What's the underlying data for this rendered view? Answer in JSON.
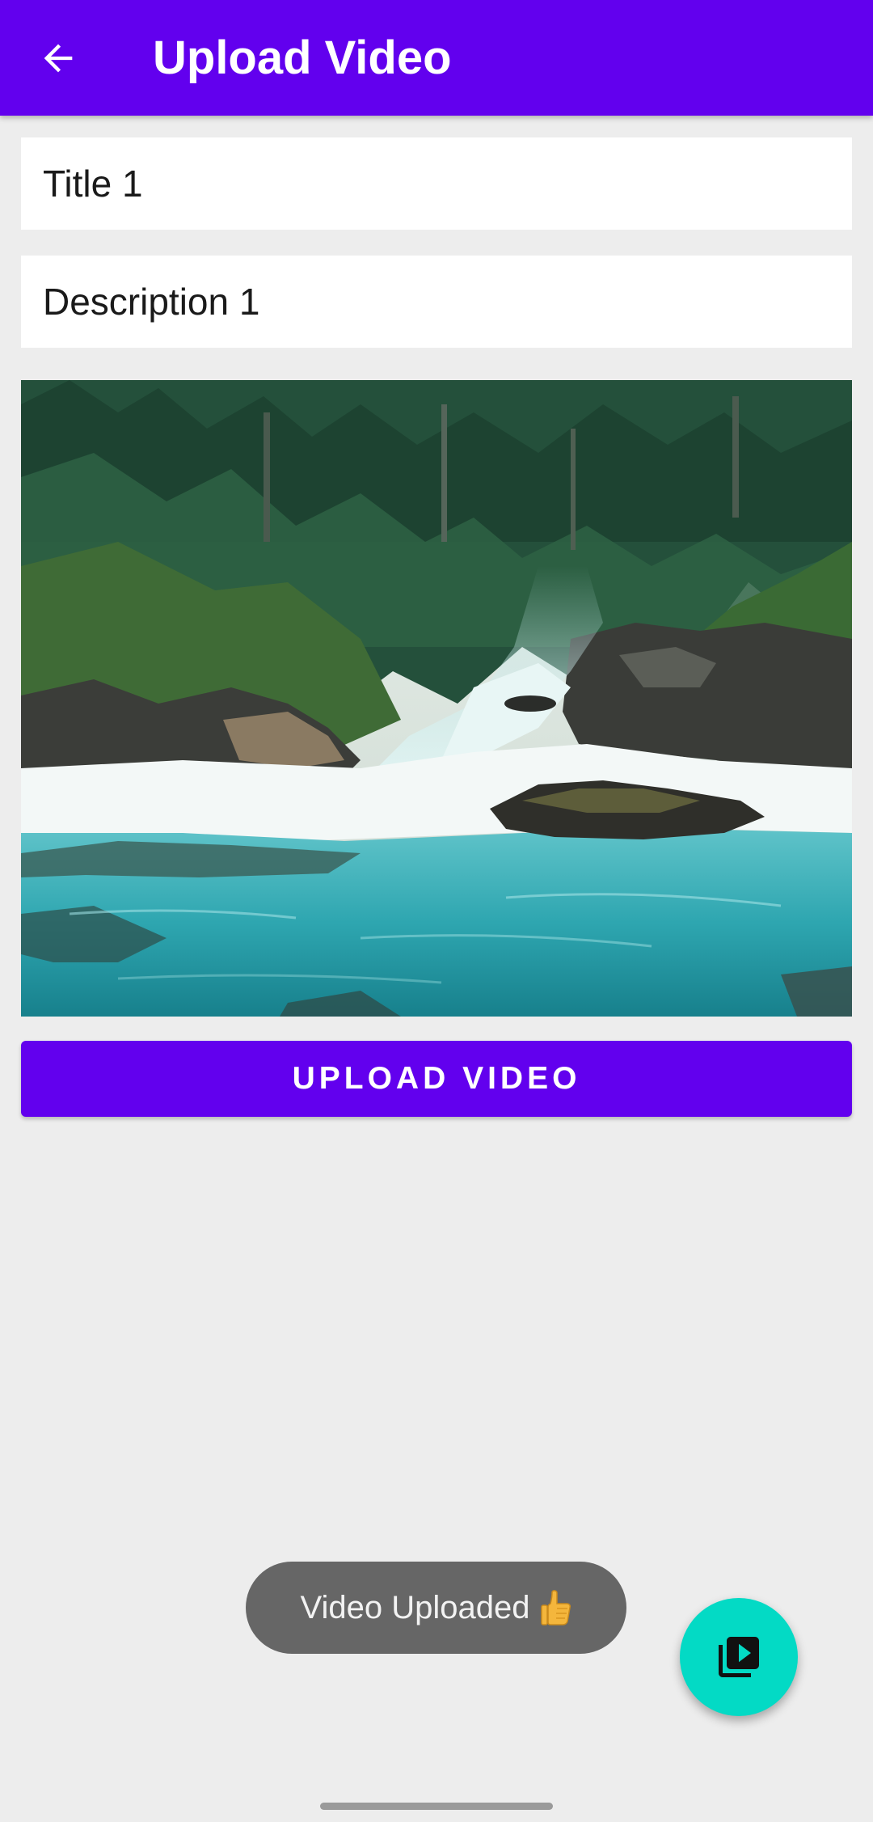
{
  "app_bar": {
    "title": "Upload Video",
    "background_color": "#6200ee",
    "back_icon": "arrow-back-icon"
  },
  "form": {
    "title_value": "Title 1",
    "description_value": "Description 1"
  },
  "video_preview": {
    "icon": "video-thumbnail-waterfall"
  },
  "upload_button": {
    "label": "UPLOAD VIDEO",
    "color": "#6200ee"
  },
  "toast": {
    "message": "Video Uploaded",
    "icon": "thumbs-up-icon"
  },
  "fab": {
    "icon": "video-library-icon",
    "color": "#03dac5"
  }
}
